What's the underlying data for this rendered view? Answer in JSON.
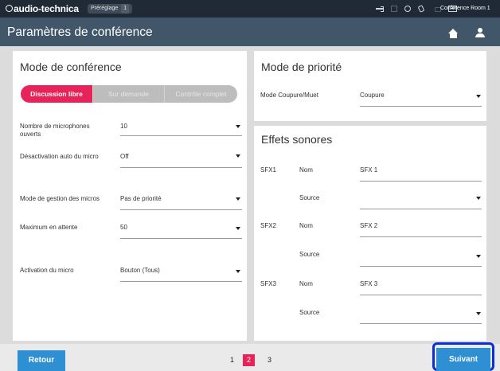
{
  "topbar": {
    "brand": "audio-technica",
    "preset_label": "Préréglage",
    "preset_number": "1",
    "room": "Conference Room 1"
  },
  "titlebar": {
    "title": "Paramètres de conférence"
  },
  "conference_mode": {
    "title": "Mode de conférence",
    "segments": [
      "Discussion libre",
      "Sur demande",
      "Contrôle complet"
    ],
    "active_segment": "Discussion libre",
    "fields": [
      {
        "label": "Nombre de microphones ouverts",
        "value": "10"
      },
      {
        "label": "Désactivation auto du micro",
        "value": "Off"
      },
      {
        "label": "Mode de gestion des micros",
        "value": "Pas de priorité"
      },
      {
        "label": "Maximum en attente",
        "value": "50"
      },
      {
        "label": "Activation du micro",
        "value": "Bouton (Tous)"
      }
    ]
  },
  "priority_mode": {
    "title": "Mode de priorité",
    "field_label": "Mode Coupure/Muet",
    "field_value": "Coupure"
  },
  "sound_effects": {
    "title": "Effets sonores",
    "name_label": "Nom",
    "source_label": "Source",
    "items": [
      {
        "id": "SFX1",
        "name": "SFX 1",
        "source": ""
      },
      {
        "id": "SFX2",
        "name": "SFX 2",
        "source": ""
      },
      {
        "id": "SFX3",
        "name": "SFX 3",
        "source": ""
      }
    ]
  },
  "footer": {
    "back_label": "Retour",
    "next_label": "Suivant",
    "pages": [
      "1",
      "2",
      "3"
    ],
    "current_page": "2"
  },
  "colors": {
    "accent": "#e8235a",
    "button": "#2f8fd3",
    "titlebar": "#42566a",
    "topbar": "#1f2a36",
    "focus_ring": "#0a2fd6"
  }
}
